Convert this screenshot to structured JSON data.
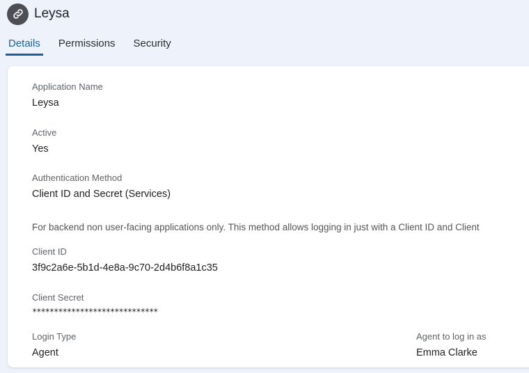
{
  "app": {
    "title": "Leysa",
    "icon": "link-icon"
  },
  "tabs": [
    {
      "label": "Details",
      "active": true
    },
    {
      "label": "Permissions",
      "active": false
    },
    {
      "label": "Security",
      "active": false
    }
  ],
  "details": {
    "application_name": {
      "label": "Application Name",
      "value": "Leysa"
    },
    "active": {
      "label": "Active",
      "value": "Yes"
    },
    "auth_method": {
      "label": "Authentication Method",
      "value": "Client ID and Secret (Services)"
    },
    "auth_note": "For backend non user-facing applications only. This method allows logging in just with a Client ID and Client",
    "client_id": {
      "label": "Client ID",
      "value": "3f9c2a6e-5b1d-4e8a-9c70-2d4b6f8a1c35"
    },
    "client_secret": {
      "label": "Client Secret",
      "value": "*****************************"
    },
    "login_type": {
      "label": "Login Type",
      "value": "Agent"
    },
    "agent": {
      "label": "Agent to log in as",
      "value": "Emma Clarke"
    }
  },
  "colors": {
    "accent": "#1b5e9a",
    "background": "#eef2fb",
    "icon_bg": "#4d4f54"
  }
}
